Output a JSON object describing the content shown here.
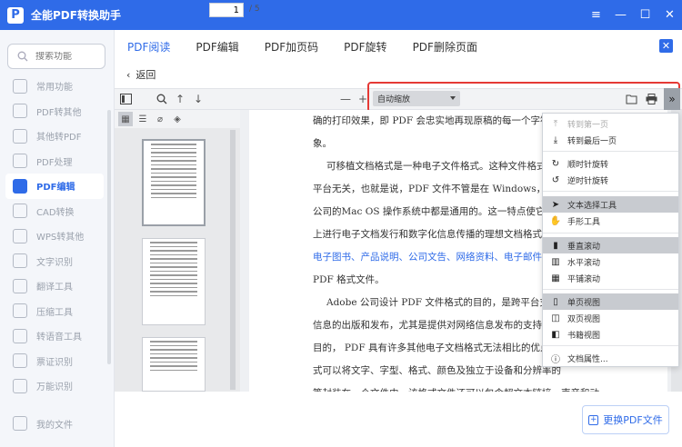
{
  "app": {
    "logo_letter": "P",
    "title": "全能PDF转换助手"
  },
  "window": {
    "menu": "≡",
    "minimize": "—",
    "maximize": "☐",
    "close": "✕"
  },
  "sidebar": {
    "search_placeholder": "搜索功能",
    "items": [
      {
        "label": "常用功能"
      },
      {
        "label": "PDF转其他"
      },
      {
        "label": "其他转PDF"
      },
      {
        "label": "PDF处理"
      },
      {
        "label": "PDF编辑"
      },
      {
        "label": "CAD转换"
      },
      {
        "label": "WPS转其他"
      },
      {
        "label": "文字识别"
      },
      {
        "label": "翻译工具"
      },
      {
        "label": "压缩工具"
      },
      {
        "label": "转语音工具"
      },
      {
        "label": "票证识别"
      },
      {
        "label": "万能识别"
      }
    ],
    "active_index": 4,
    "my_files": "我的文件"
  },
  "tabs": [
    {
      "label": "PDF阅读"
    },
    {
      "label": "PDF编辑"
    },
    {
      "label": "PDF加页码"
    },
    {
      "label": "PDF旋转"
    },
    {
      "label": "PDF删除页面"
    }
  ],
  "back_label": "返回",
  "toolbar": {
    "page_value": "1",
    "page_total": "/ 5",
    "zoom_value": "自动缩放",
    "minus": "—",
    "plus": "+",
    "more": "»"
  },
  "document": {
    "lines": [
      "确的打印效果，即 PDF 会忠实地再现原稿的每一个字符、",
      "象。",
      "可移植文档格式是一种电子文件格式。这种文件格式与",
      "平台无关，也就是说，PDF 文件不管是在 Windows，Unix",
      "公司的Mac OS 操作系统中都是通用的。这一特点使它成为",
      "上进行电子文档发行和数字化信息传播的理想文档格式。",
      "电子图书、产品说明、公司文告、网络资料、电子邮件",
      "PDF 格式文件。",
      "Adobe 公司设计 PDF 文件格式的目的，是跨平台支持",
      "信息的出版和发布，尤其是提供对网络信息发布的支持。",
      "目的， PDF 具有许多其他电子文档格式无法相比的优点。",
      "式可以将文字、字型、格式、颜色及独立于设备和分辨率的",
      "等封装在一个文件中。该格式文件还可以包含超文本链接、声音和动"
    ]
  },
  "menu": {
    "items": [
      {
        "label": "转到第一页",
        "icon": "first-page-icon"
      },
      {
        "label": "转到最后一页",
        "icon": "last-page-icon"
      },
      {
        "label": "顺时针旋转",
        "icon": "rotate-cw-icon"
      },
      {
        "label": "逆时针旋转",
        "icon": "rotate-ccw-icon"
      },
      {
        "label": "文本选择工具",
        "icon": "cursor-icon"
      },
      {
        "label": "手形工具",
        "icon": "hand-icon"
      },
      {
        "label": "垂直滚动",
        "icon": "vertical-scroll-icon"
      },
      {
        "label": "水平滚动",
        "icon": "horizontal-scroll-icon"
      },
      {
        "label": "平铺滚动",
        "icon": "wrapped-scroll-icon"
      },
      {
        "label": "单页视图",
        "icon": "single-page-icon"
      },
      {
        "label": "双页视图",
        "icon": "odd-spread-icon"
      },
      {
        "label": "书籍视图",
        "icon": "even-spread-icon"
      },
      {
        "label": "文档属性...",
        "icon": "info-icon"
      }
    ]
  },
  "replace_button": {
    "label": "更换PDF文件"
  },
  "colors": {
    "accent": "#2f6be8",
    "highlight": "#e53935",
    "menu_selected": "#c8cbd0"
  }
}
